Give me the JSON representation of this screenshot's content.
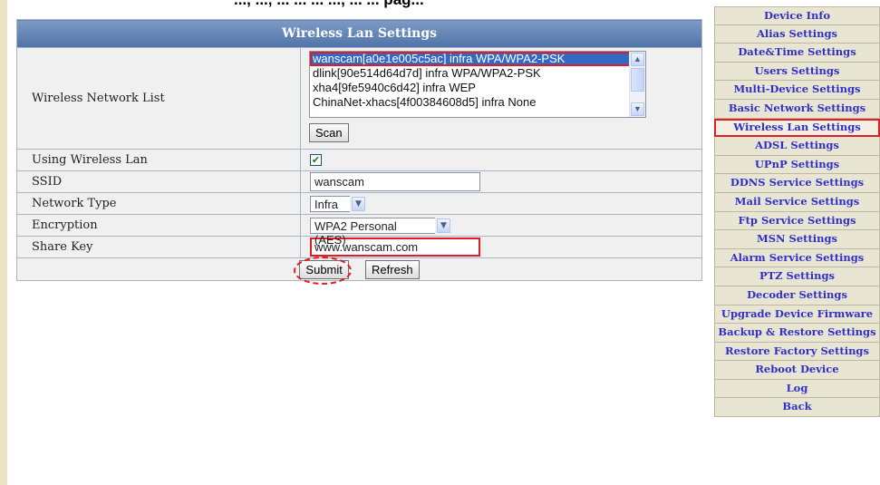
{
  "top_text": "..., ..., ... ... ... ..., ... ... pag...",
  "panel": {
    "title": "Wireless Lan Settings",
    "network_list_label": "Wireless Network List",
    "networks": [
      "wanscam[a0e1e005c5ac] infra WPA/WPA2-PSK",
      "dlink[90e514d64d7d] infra WPA/WPA2-PSK",
      "xha4[9fe5940c6d42] infra WEP",
      "ChinaNet-xhacs[4f00384608d5] infra None"
    ],
    "selected_network_index": 0,
    "scan_label": "Scan",
    "using_wireless_label": "Using Wireless Lan",
    "using_wireless_checked": true,
    "ssid_label": "SSID",
    "ssid_value": "wanscam",
    "network_type_label": "Network Type",
    "network_type_value": "Infra",
    "encryption_label": "Encryption",
    "encryption_value": "WPA2 Personal (AES)",
    "share_key_label": "Share Key",
    "share_key_value": "www.wanscam.com",
    "submit_label": "Submit",
    "refresh_label": "Refresh"
  },
  "menu": {
    "items": [
      "Device Info",
      "Alias Settings",
      "Date&Time Settings",
      "Users Settings",
      "Multi-Device Settings",
      "Basic Network Settings",
      "Wireless Lan Settings",
      "ADSL Settings",
      "UPnP Settings",
      "DDNS Service Settings",
      "Mail Service Settings",
      "Ftp Service Settings",
      "MSN Settings",
      "Alarm Service Settings",
      "PTZ Settings",
      "Decoder Settings",
      "Upgrade Device Firmware",
      "Backup & Restore Settings",
      "Restore Factory Settings",
      "Reboot Device",
      "Log",
      "Back"
    ],
    "active_index": 6
  },
  "colors": {
    "header_bg": "#5f80b4",
    "highlight": "#e01c24",
    "menu_text": "#3030c8",
    "menu_bg": "#e9e5d3"
  }
}
